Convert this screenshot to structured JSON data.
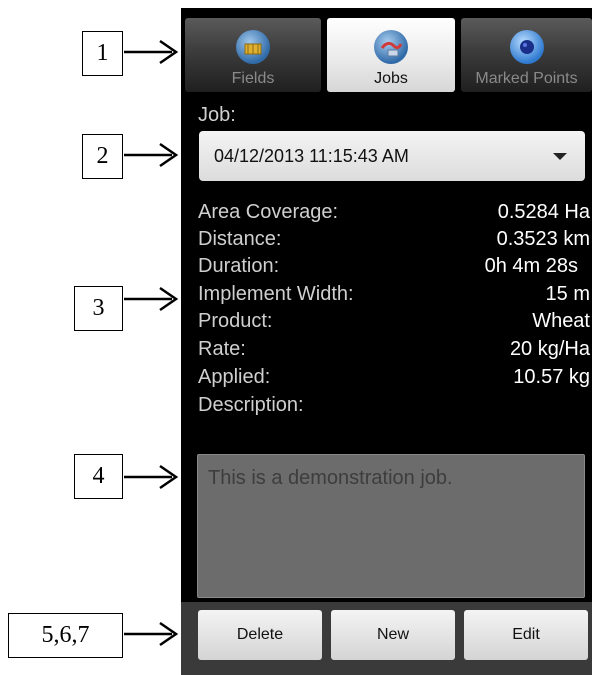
{
  "callouts": [
    "1",
    "2",
    "3",
    "4",
    "5,6,7"
  ],
  "tabs": [
    {
      "label": "Fields",
      "icon": "fields-icon",
      "active": false
    },
    {
      "label": "Jobs",
      "icon": "jobs-icon",
      "active": true
    },
    {
      "label": "Marked Points",
      "icon": "marked-points-icon",
      "active": false
    }
  ],
  "job": {
    "label": "Job:",
    "selected": "04/12/2013 11:15:43 AM"
  },
  "details": [
    {
      "label": "Area Coverage:",
      "value": "0.5284 Ha"
    },
    {
      "label": "Distance:",
      "value": "0.3523 km"
    },
    {
      "label": "Duration:",
      "value": "0h 4m 28s"
    },
    {
      "label": "Implement Width:",
      "value": "15 m"
    },
    {
      "label": "Product:",
      "value": "Wheat"
    },
    {
      "label": "Rate:",
      "value": "20 kg/Ha"
    },
    {
      "label": "Applied:",
      "value": "10.57 kg"
    }
  ],
  "description": {
    "label": "Description:",
    "text": "This is a demonstration job."
  },
  "buttons": {
    "delete": "Delete",
    "new": "New",
    "edit": "Edit"
  },
  "colors": {
    "background": "#000000",
    "value_text": "#ffffff",
    "label_text": "#cfcfcf",
    "description_bg": "#6c6c6c",
    "button_bar": "#3a3a3a"
  }
}
